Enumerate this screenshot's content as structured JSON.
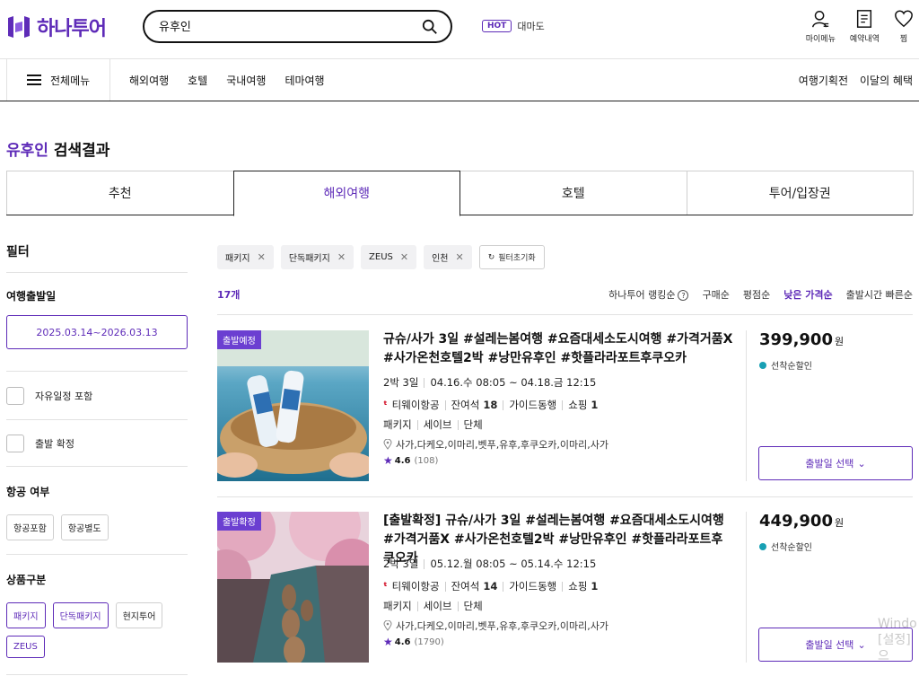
{
  "header": {
    "logo_text": "하나투어",
    "search_value": "유후인",
    "hot_badge": "HOT",
    "hot_keyword": "대마도",
    "icons": [
      {
        "name": "my-menu",
        "label": "마이메뉴"
      },
      {
        "name": "reservation",
        "label": "예약내역"
      },
      {
        "name": "wish",
        "label": "찜"
      }
    ]
  },
  "nav": {
    "all_menu": "전체메뉴",
    "links": [
      "해외여행",
      "호텔",
      "국내여행",
      "테마여행"
    ],
    "right_links": [
      "여행기획전",
      "이달의 혜택"
    ]
  },
  "page": {
    "keyword": "유후인",
    "title_suffix": " 검색결과"
  },
  "tabs": [
    "추천",
    "해외여행",
    "호텔",
    "투어/입장권"
  ],
  "active_tab": 1,
  "sidebar": {
    "title": "필터",
    "departure_label": "여행출발일",
    "date_range": "2025.03.14~2026.03.13",
    "free_schedule": "자유일정 포함",
    "confirmed": "출발 확정",
    "airline_label": "항공 여부",
    "airline_chips": [
      "항공포함",
      "항공별도"
    ],
    "product_label": "상품구분",
    "product_chips": [
      {
        "label": "패키지",
        "selected": true
      },
      {
        "label": "단독패키지",
        "selected": true
      },
      {
        "label": "현지투어",
        "selected": false
      },
      {
        "label": "ZEUS",
        "selected": true
      }
    ]
  },
  "filters": {
    "tags": [
      "패키지",
      "단독패키지",
      "ZEUS",
      "인천"
    ],
    "reset": "필터초기화"
  },
  "results": {
    "count": "17개",
    "sorts": [
      "하나투어 랭킹순",
      "구매순",
      "평점순",
      "낮은 가격순",
      "출발시간 빠른순"
    ],
    "active_sort": 3
  },
  "products": [
    {
      "badge": "출발예정",
      "title": "규슈/사가 3일 #설레는봄여행 #요즘대세소도시여행 #가격거품X #사가온천호텔2박 #낭만유후인 #핫플라라포트후쿠오카",
      "duration": "2박 3일",
      "schedule": "04.16.수 08:05 ~ 04.18.금 12:15",
      "airline": "티웨이항공",
      "seats_label": "잔여석",
      "seats": "18",
      "guide": "가이드동행",
      "shopping_label": "쇼핑",
      "shopping": "1",
      "types": [
        "패키지",
        "세이브",
        "단체"
      ],
      "route": "사가,다케오,이마리,벳푸,유후,후쿠오카,이마리,사가",
      "rating": "4.6",
      "reviews": "(108)",
      "price": "399,900",
      "price_unit": "원",
      "discount": "선착순할인",
      "select_label": "출발일 선택"
    },
    {
      "badge": "출발확정",
      "title": "[출발확정] 규슈/사가 3일 #설레는봄여행 #요즘대세소도시여행 #가격거품X #사가온천호텔2박 #낭만유후인 #핫플라라포트후쿠오카",
      "duration": "2박 3일",
      "schedule": "05.12.월 08:05 ~ 05.14.수 12:15",
      "airline": "티웨이항공",
      "seats_label": "잔여석",
      "seats": "14",
      "guide": "가이드동행",
      "shopping_label": "쇼핑",
      "shopping": "1",
      "types": [
        "패키지",
        "세이브",
        "단체"
      ],
      "route": "사가,다케오,이마리,벳푸,유후,후쿠오카,이마리,사가",
      "rating": "4.6",
      "reviews": "(1790)",
      "price": "449,900",
      "price_unit": "원",
      "discount": "선착순할인",
      "select_label": "출발일 선택"
    }
  ],
  "watermark": [
    "Windo",
    "[설정]으"
  ],
  "colors": {
    "brand": "#5e2bb8",
    "discount_dot": "#18a0b4",
    "airline": "#d0021b"
  }
}
